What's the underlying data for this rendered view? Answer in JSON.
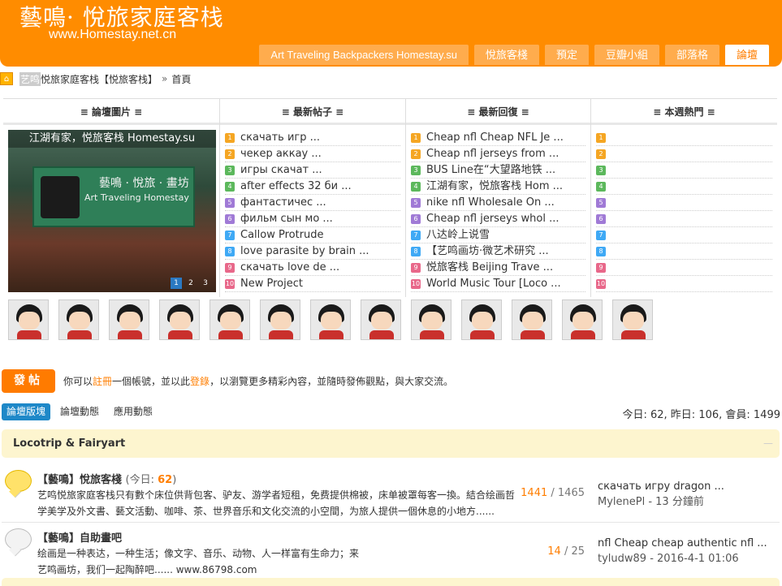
{
  "header": {
    "title": "藝鳴· 悅旅家庭客栈",
    "url": "www.Homestay.net.cn",
    "nav": [
      {
        "label": "Art Traveling Backpackers Homestay.su",
        "active": false
      },
      {
        "label": "悅旅客棧",
        "active": false
      },
      {
        "label": "預定",
        "active": false
      },
      {
        "label": "豆瓣小組",
        "active": false
      },
      {
        "label": "部落格",
        "active": false
      },
      {
        "label": "論壇",
        "active": true
      }
    ]
  },
  "breadcrumb": {
    "site": "艺鸣",
    "site_name": "悦旅家庭客栈【悦旅客栈】",
    "sep": "»",
    "current": "首頁"
  },
  "panels": {
    "pics": {
      "title": "≡ 論壇圖片 ≡",
      "caption": "江湖有家，悦旅客栈 Homestay.su",
      "sign_line1": "藝鳴 · 悅旅 · 畫坊",
      "sign_line2": "Art Traveling Homestay",
      "slides": [
        "1",
        "2",
        "3"
      ]
    },
    "new_posts": {
      "title": "≡ 最新帖子 ≡",
      "items": [
        "скачать игр ...",
        "чекер аккау ...",
        "игры скачат ...",
        "after effects 32 би ...",
        "фантастичес ...",
        "фильм сын мо ...",
        "Callow Protrude",
        "love parasite by brain ...",
        "скачать love de ...",
        "New Project"
      ]
    },
    "new_replies": {
      "title": "≡ 最新回復 ≡",
      "items": [
        "Cheap nfl Cheap NFL Je ...",
        "Cheap nfl jerseys from ...",
        "BUS Line在“大望路地铁 ...",
        "江湖有家，悦旅客栈 Hom ...",
        "nike nfl Wholesale On ...",
        "Cheap nfl jerseys whol ...",
        "八达岭上说雪",
        "【艺鸣画坊·微艺术研究 ...",
        "悦旅客栈 Beijing Trave ...",
        "World Music Tour [Loco ..."
      ]
    },
    "weekly_hot": {
      "title": "≡ 本週熱門 ≡",
      "items": [
        "",
        "",
        "",
        "",
        "",
        "",
        "",
        "",
        "",
        ""
      ]
    },
    "rank_numbers": [
      "1",
      "2",
      "3",
      "4",
      "5",
      "6",
      "7",
      "8",
      "9",
      "10"
    ],
    "rank_colors": [
      "#f5a623",
      "#f5a623",
      "#5cb85c",
      "#5cb85c",
      "#a07ad6",
      "#a07ad6",
      "#3fa9f5",
      "#3fa9f5",
      "#e8688a",
      "#e8688a"
    ]
  },
  "avatar_count": 13,
  "post": {
    "button": "發帖",
    "note_prefix": "你可以",
    "register": "註冊",
    "note_mid": "一個帳號，並以此",
    "login": "登錄",
    "note_suffix": "，以瀏覽更多精彩內容，並隨時發佈觀點，與大家交流。"
  },
  "tabs": [
    "論壇版塊",
    "論壇動態",
    "應用動態"
  ],
  "stats": "今日: 62, 昨日: 106, 會員: 1499",
  "group": {
    "title": "Locotrip & Fairyart",
    "collapse": "—"
  },
  "forums": [
    {
      "name": "【藝鳴】悅旅客棧",
      "today_label": "(今日: ",
      "today": "62",
      "today_close": ")",
      "desc": "艺鸣悦旅家庭客栈只有數个床位供背包客、驴友、游学者短租，免费提供棉被，床单被罩每客一換。結合绘画哲学美学及外文書、藝文活動、咖啡、茶、世界音乐和文化交流的小空間，为旅人提供一個休息的小地方......",
      "topics": "1441",
      "posts": "/ 1465",
      "last_title": "скачать игру dragon ...",
      "last_meta": "MylenePl - 13 分鐘前"
    },
    {
      "name": "【藝鳴】自助畫吧",
      "today_label": "",
      "today": "",
      "today_close": "",
      "desc": "绘画是一种表达，一种生活；像文字、音乐、动物、人一样富有生命力；来艺鸣画坊，我们一起陶醉吧...... www.86798.com",
      "topics": "14",
      "posts": "/ 25",
      "last_title": "nfl Cheap cheap authentic nfl ...",
      "last_meta": "tyludw89 - 2016-4-1 01:06"
    }
  ]
}
